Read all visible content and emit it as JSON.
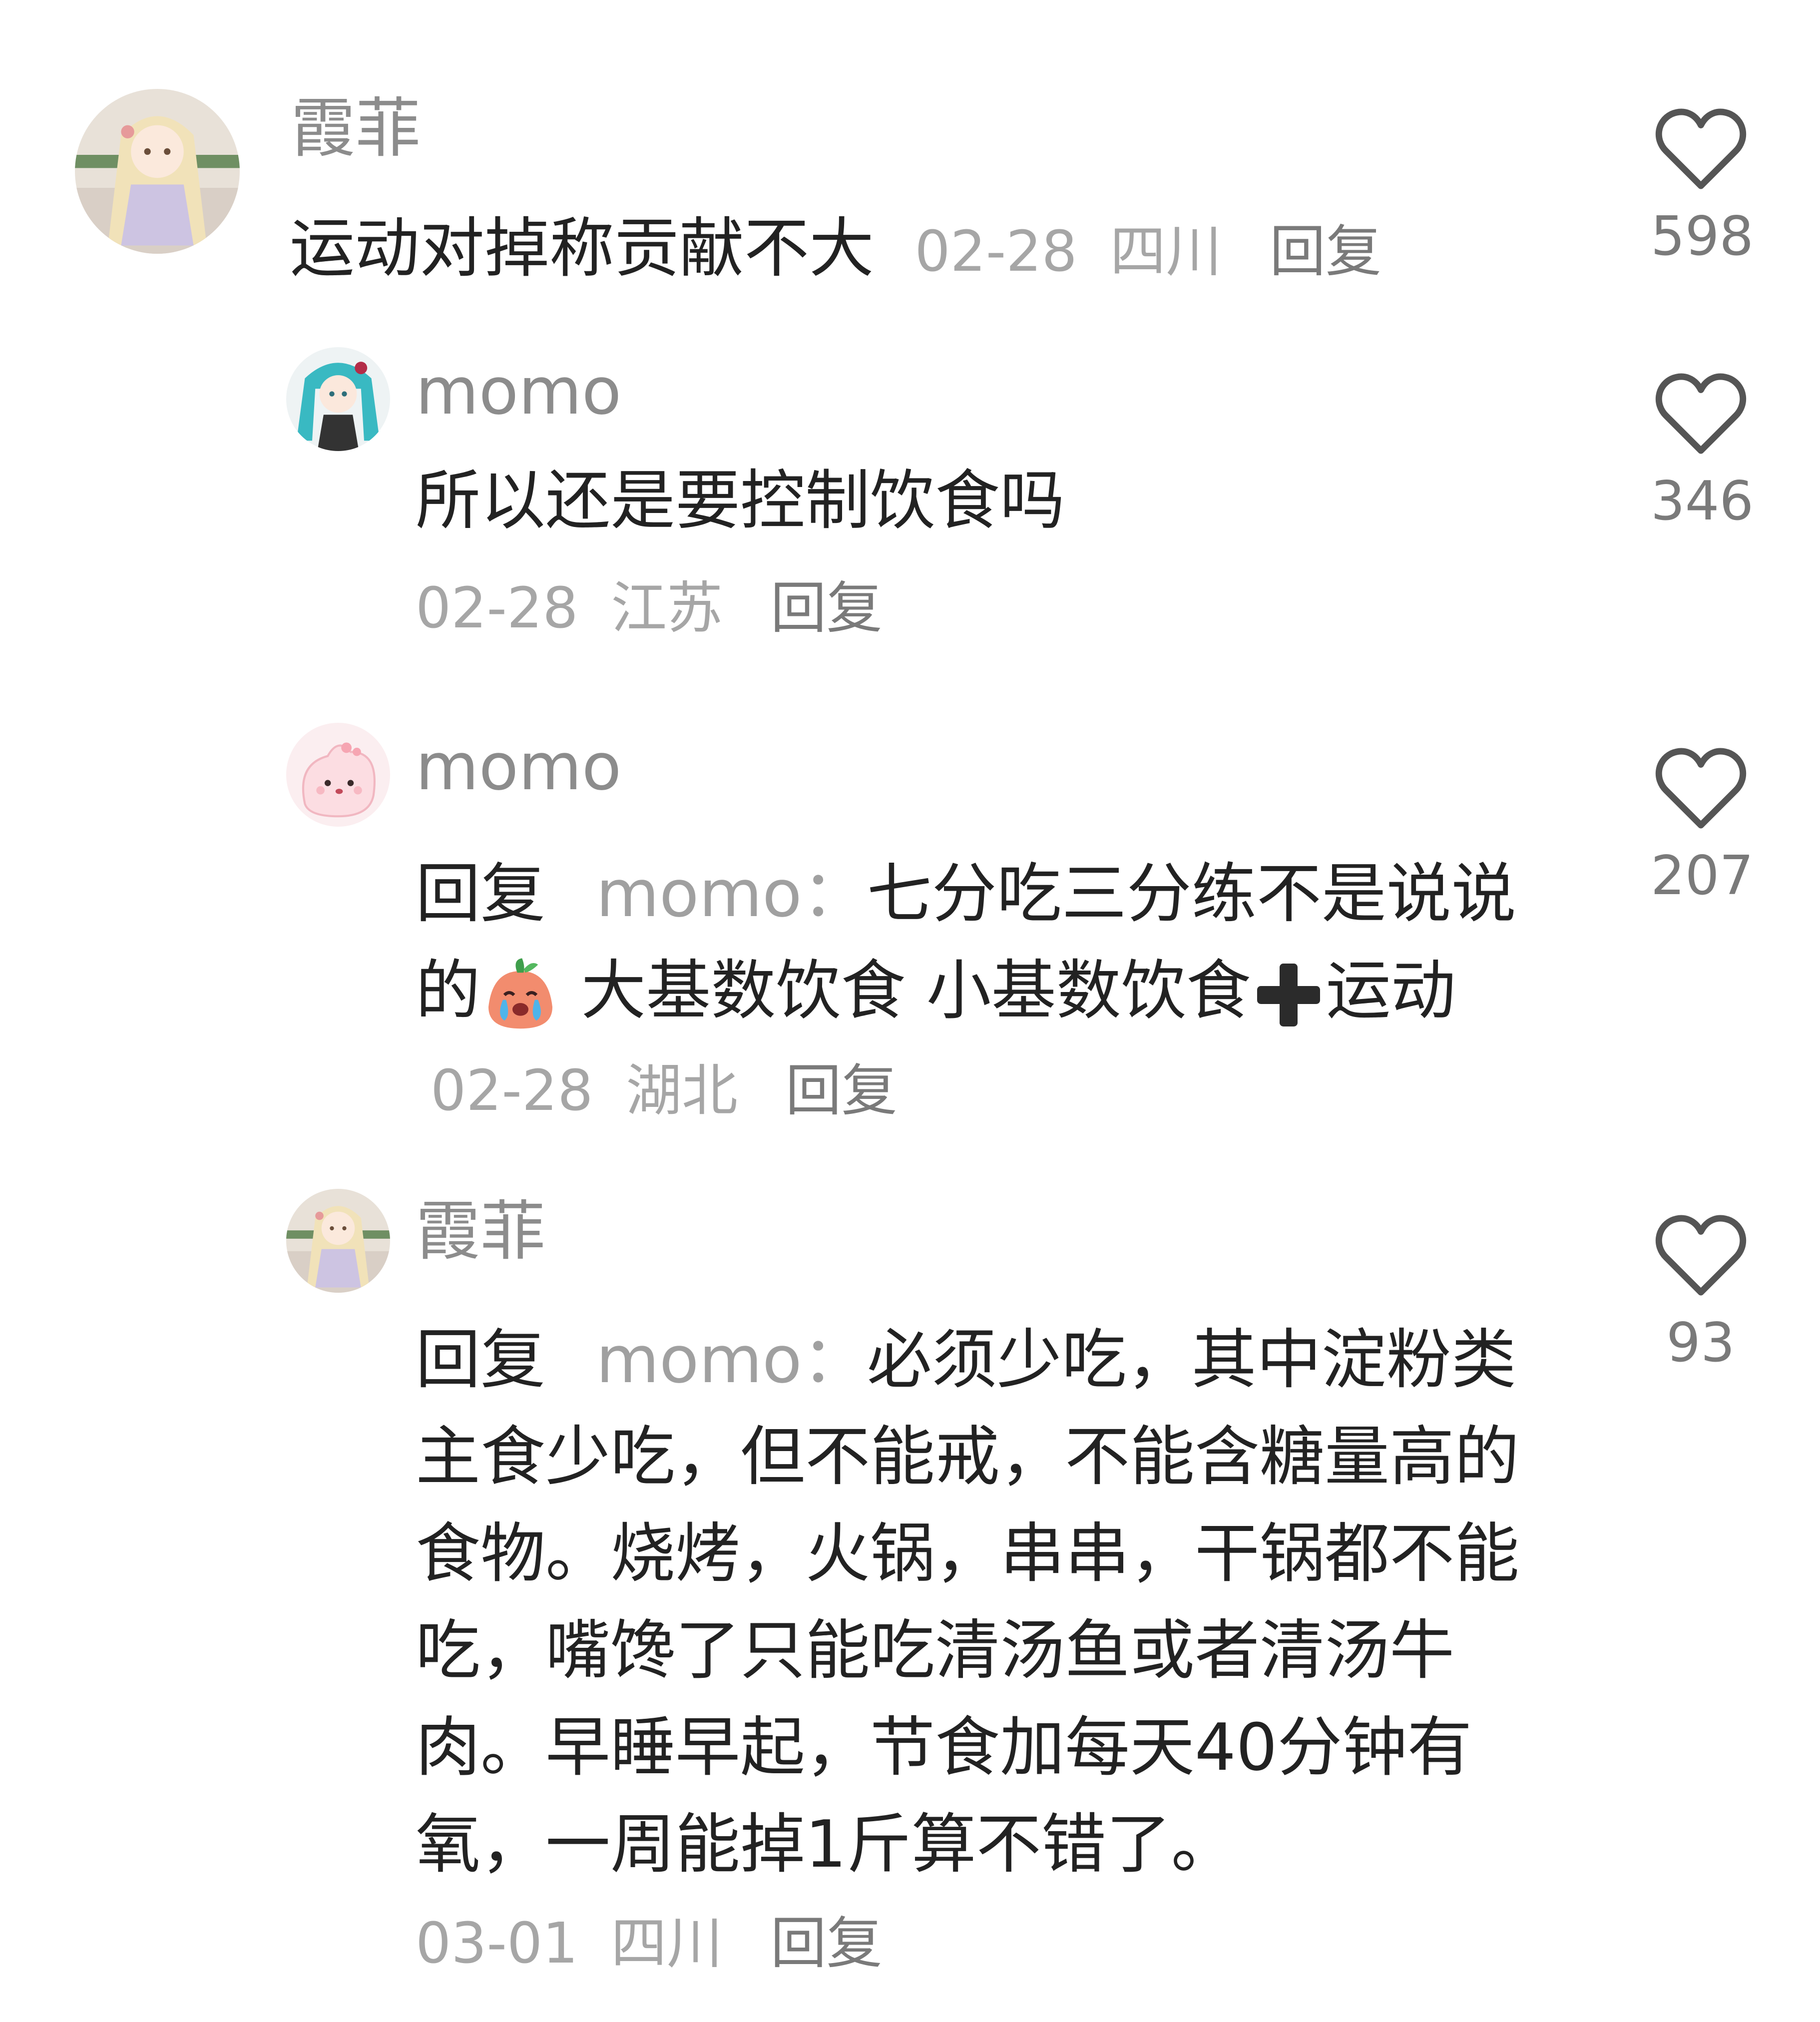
{
  "comments": [
    {
      "username": "霞菲",
      "text": "运动对掉称贡献不大",
      "date": "02-28",
      "location": "四川",
      "reply_label": "回复",
      "likes": "598",
      "avatar": "girl-blonde-avatar"
    },
    {
      "username": "momo",
      "text": "所以还是要控制饮食吗",
      "date": "02-28",
      "location": "江苏",
      "reply_label": "回复",
      "likes": "346",
      "avatar": "teal-hair-avatar"
    },
    {
      "username": "momo",
      "reply_prefix": "回复",
      "mention": "momo：",
      "text_part1": "七分吃三分练不是说说的",
      "emoji": "crying-peach-emoji",
      "text_part2": " 大基数饮食 小基数饮食",
      "plus_emoji": "heavy-plus-emoji",
      "text_part3": "运动",
      "date": "02-28",
      "location": "湖北",
      "reply_label": "回复",
      "likes": "207",
      "avatar": "pink-blob-avatar"
    },
    {
      "username": "霞菲",
      "reply_prefix": "回复",
      "mention": "momo：",
      "text": "必须少吃，其中淀粉类主食少吃，但不能戒，不能含糖量高的食物。烧烤，火锅，串串，干锅都不能吃，嘴馋了只能吃清汤鱼或者清汤牛肉。早睡早起，节食加每天40分钟有氧，一周能掉1斤算不错了。",
      "date": "03-01",
      "location": "四川",
      "reply_label": "回复",
      "likes": "93",
      "avatar": "girl-blonde-avatar"
    }
  ],
  "colors": {
    "username": "#8c8c8c",
    "body": "#222222",
    "meta": "#a6a6a6",
    "heart_stroke": "#555555"
  }
}
